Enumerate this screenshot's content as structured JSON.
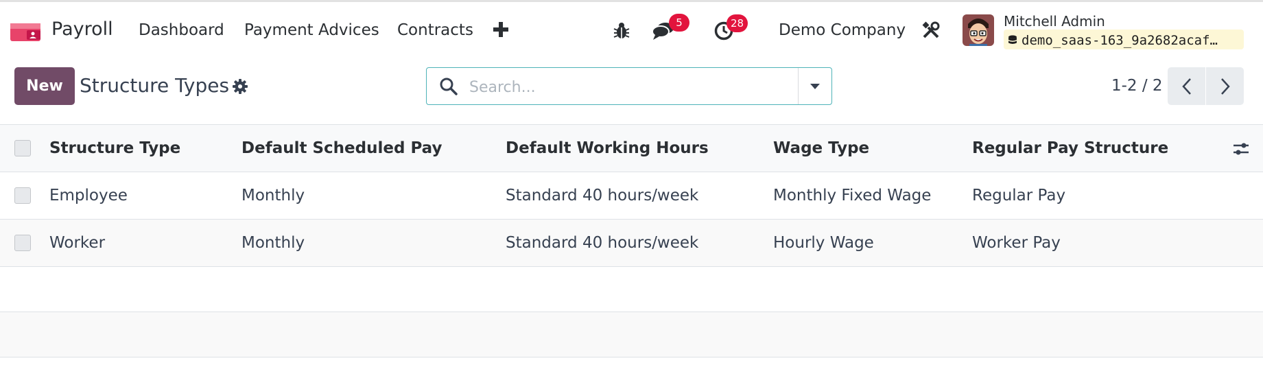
{
  "topbar": {
    "app_name": "Payroll",
    "nav": [
      "Dashboard",
      "Payment Advices",
      "Contracts"
    ],
    "messages_count": "5",
    "activities_count": "28",
    "company": "Demo Company",
    "user_name": "Mitchell Admin",
    "database": "demo_saas-163_9a2682acaf…"
  },
  "control_panel": {
    "new_label": "New",
    "title": "Structure Types",
    "search_placeholder": "Search...",
    "pager": "1-2 / 2"
  },
  "table": {
    "columns": [
      "Structure Type",
      "Default Scheduled Pay",
      "Default Working Hours",
      "Wage Type",
      "Regular Pay Structure"
    ],
    "rows": [
      [
        "Employee",
        "Monthly",
        "Standard 40 hours/week",
        "Monthly Fixed Wage",
        "Regular Pay"
      ],
      [
        "Worker",
        "Monthly",
        "Standard 40 hours/week",
        "Hourly Wage",
        "Worker Pay"
      ]
    ]
  },
  "colors": {
    "primary": "#714b67",
    "badge": "#e2143d",
    "search_border": "#4eb3b8",
    "database_pill": "#fdf7d6"
  },
  "icons": [
    "brand-icon",
    "plus-icon",
    "bug-icon",
    "chat-icon",
    "clock-icon",
    "tools-icon",
    "database-icon",
    "gear-icon",
    "search-icon",
    "caret-down-icon",
    "chevron-left-icon",
    "chevron-right-icon",
    "optional-columns-icon"
  ]
}
